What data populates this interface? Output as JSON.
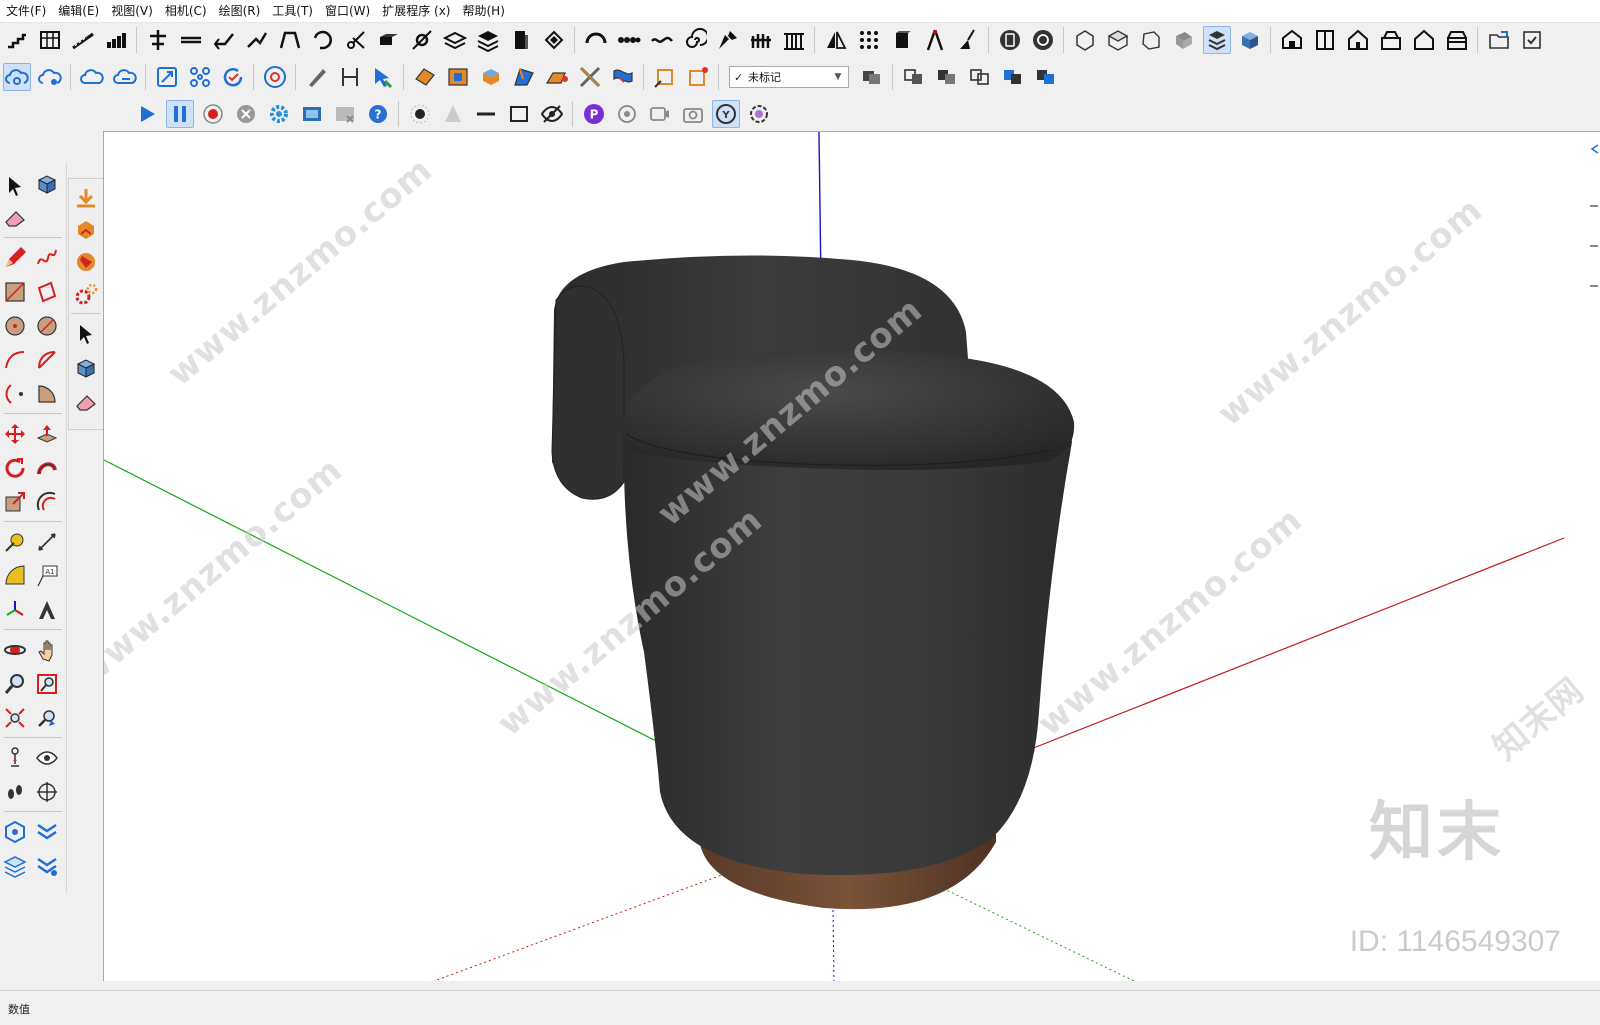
{
  "menu": {
    "file": "文件(F)",
    "edit": "编辑(E)",
    "view": "视图(V)",
    "camera": "相机(C)",
    "draw": "绘图(R)",
    "tools": "工具(T)",
    "window": "窗口(W)",
    "extensions": "扩展程序 (x)",
    "help": "帮助(H)"
  },
  "tag_dropdown": {
    "value": "未标记",
    "check": "✓"
  },
  "status": {
    "measurements_label": "数值"
  },
  "watermark": {
    "site": "www.znzmo.com",
    "site_cn": "知末网",
    "brand": "知末",
    "id_text": "ID: 1146549307"
  },
  "colors": {
    "accent_blue": "#1f6fd6",
    "axis_red": "#c41818",
    "axis_green": "#15a815",
    "axis_blue": "#1414c8",
    "sofa_body": "#3a3a3a",
    "sofa_base": "#7a5238"
  }
}
